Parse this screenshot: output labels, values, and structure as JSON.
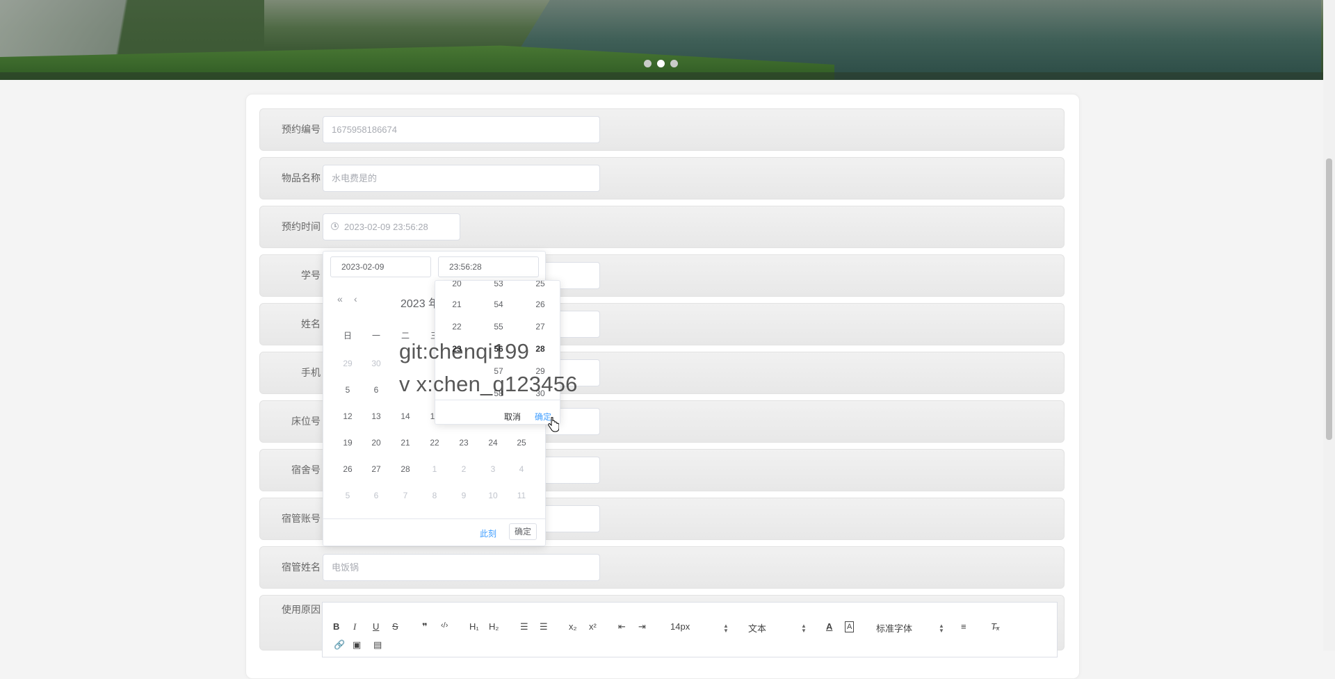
{
  "carousel": {
    "dots": 3,
    "active": 1
  },
  "form": {
    "rows": [
      {
        "label": "预约编号",
        "value": "1675958186674"
      },
      {
        "label": "物品名称",
        "value": "水电费是的"
      },
      {
        "label": "预约时间",
        "value": "2023-02-09 23:56:28"
      },
      {
        "label": "学号",
        "value": ""
      },
      {
        "label": "姓名",
        "value": ""
      },
      {
        "label": "手机",
        "value": ""
      },
      {
        "label": "床位号",
        "value": ""
      },
      {
        "label": "宿舍号",
        "value": ""
      },
      {
        "label": "宿管账号",
        "value": ""
      },
      {
        "label": "宿管姓名",
        "value": "电饭锅"
      },
      {
        "label": "使用原因",
        "value": ""
      }
    ]
  },
  "picker": {
    "date_input": "2023-02-09",
    "time_input": "23:56:28",
    "nav_prev_year": "«",
    "nav_prev_month": "‹",
    "month_label": "2023 年",
    "weekdays": [
      "日",
      "一",
      "二",
      "三"
    ],
    "days": [
      [
        "29",
        "30"
      ],
      [
        "5",
        "6"
      ],
      [
        "12",
        "13",
        "14",
        "1"
      ],
      [
        "19",
        "20",
        "21",
        "22",
        "23",
        "24",
        "25"
      ],
      [
        "26",
        "27",
        "28",
        "1",
        "2",
        "3",
        "4"
      ],
      [
        "5",
        "6",
        "7",
        "8",
        "9",
        "10",
        "11"
      ]
    ],
    "now_label": "此刻",
    "ok_label": "确定"
  },
  "time_panel": {
    "col1": [
      "20",
      "21",
      "22",
      "23",
      "57",
      "58"
    ],
    "col2": [
      "53",
      "54",
      "55",
      "56",
      "57",
      "58"
    ],
    "col3": [
      "25",
      "26",
      "27",
      "28",
      "29",
      "30"
    ],
    "cancel_label": "取消",
    "confirm_label": "确定"
  },
  "watermark": {
    "line1": "git:chenqi199",
    "line2": "v x:chen_q123456"
  },
  "editor": {
    "font_size": "14px",
    "text_type": "文本",
    "font_family": "标准字体"
  }
}
